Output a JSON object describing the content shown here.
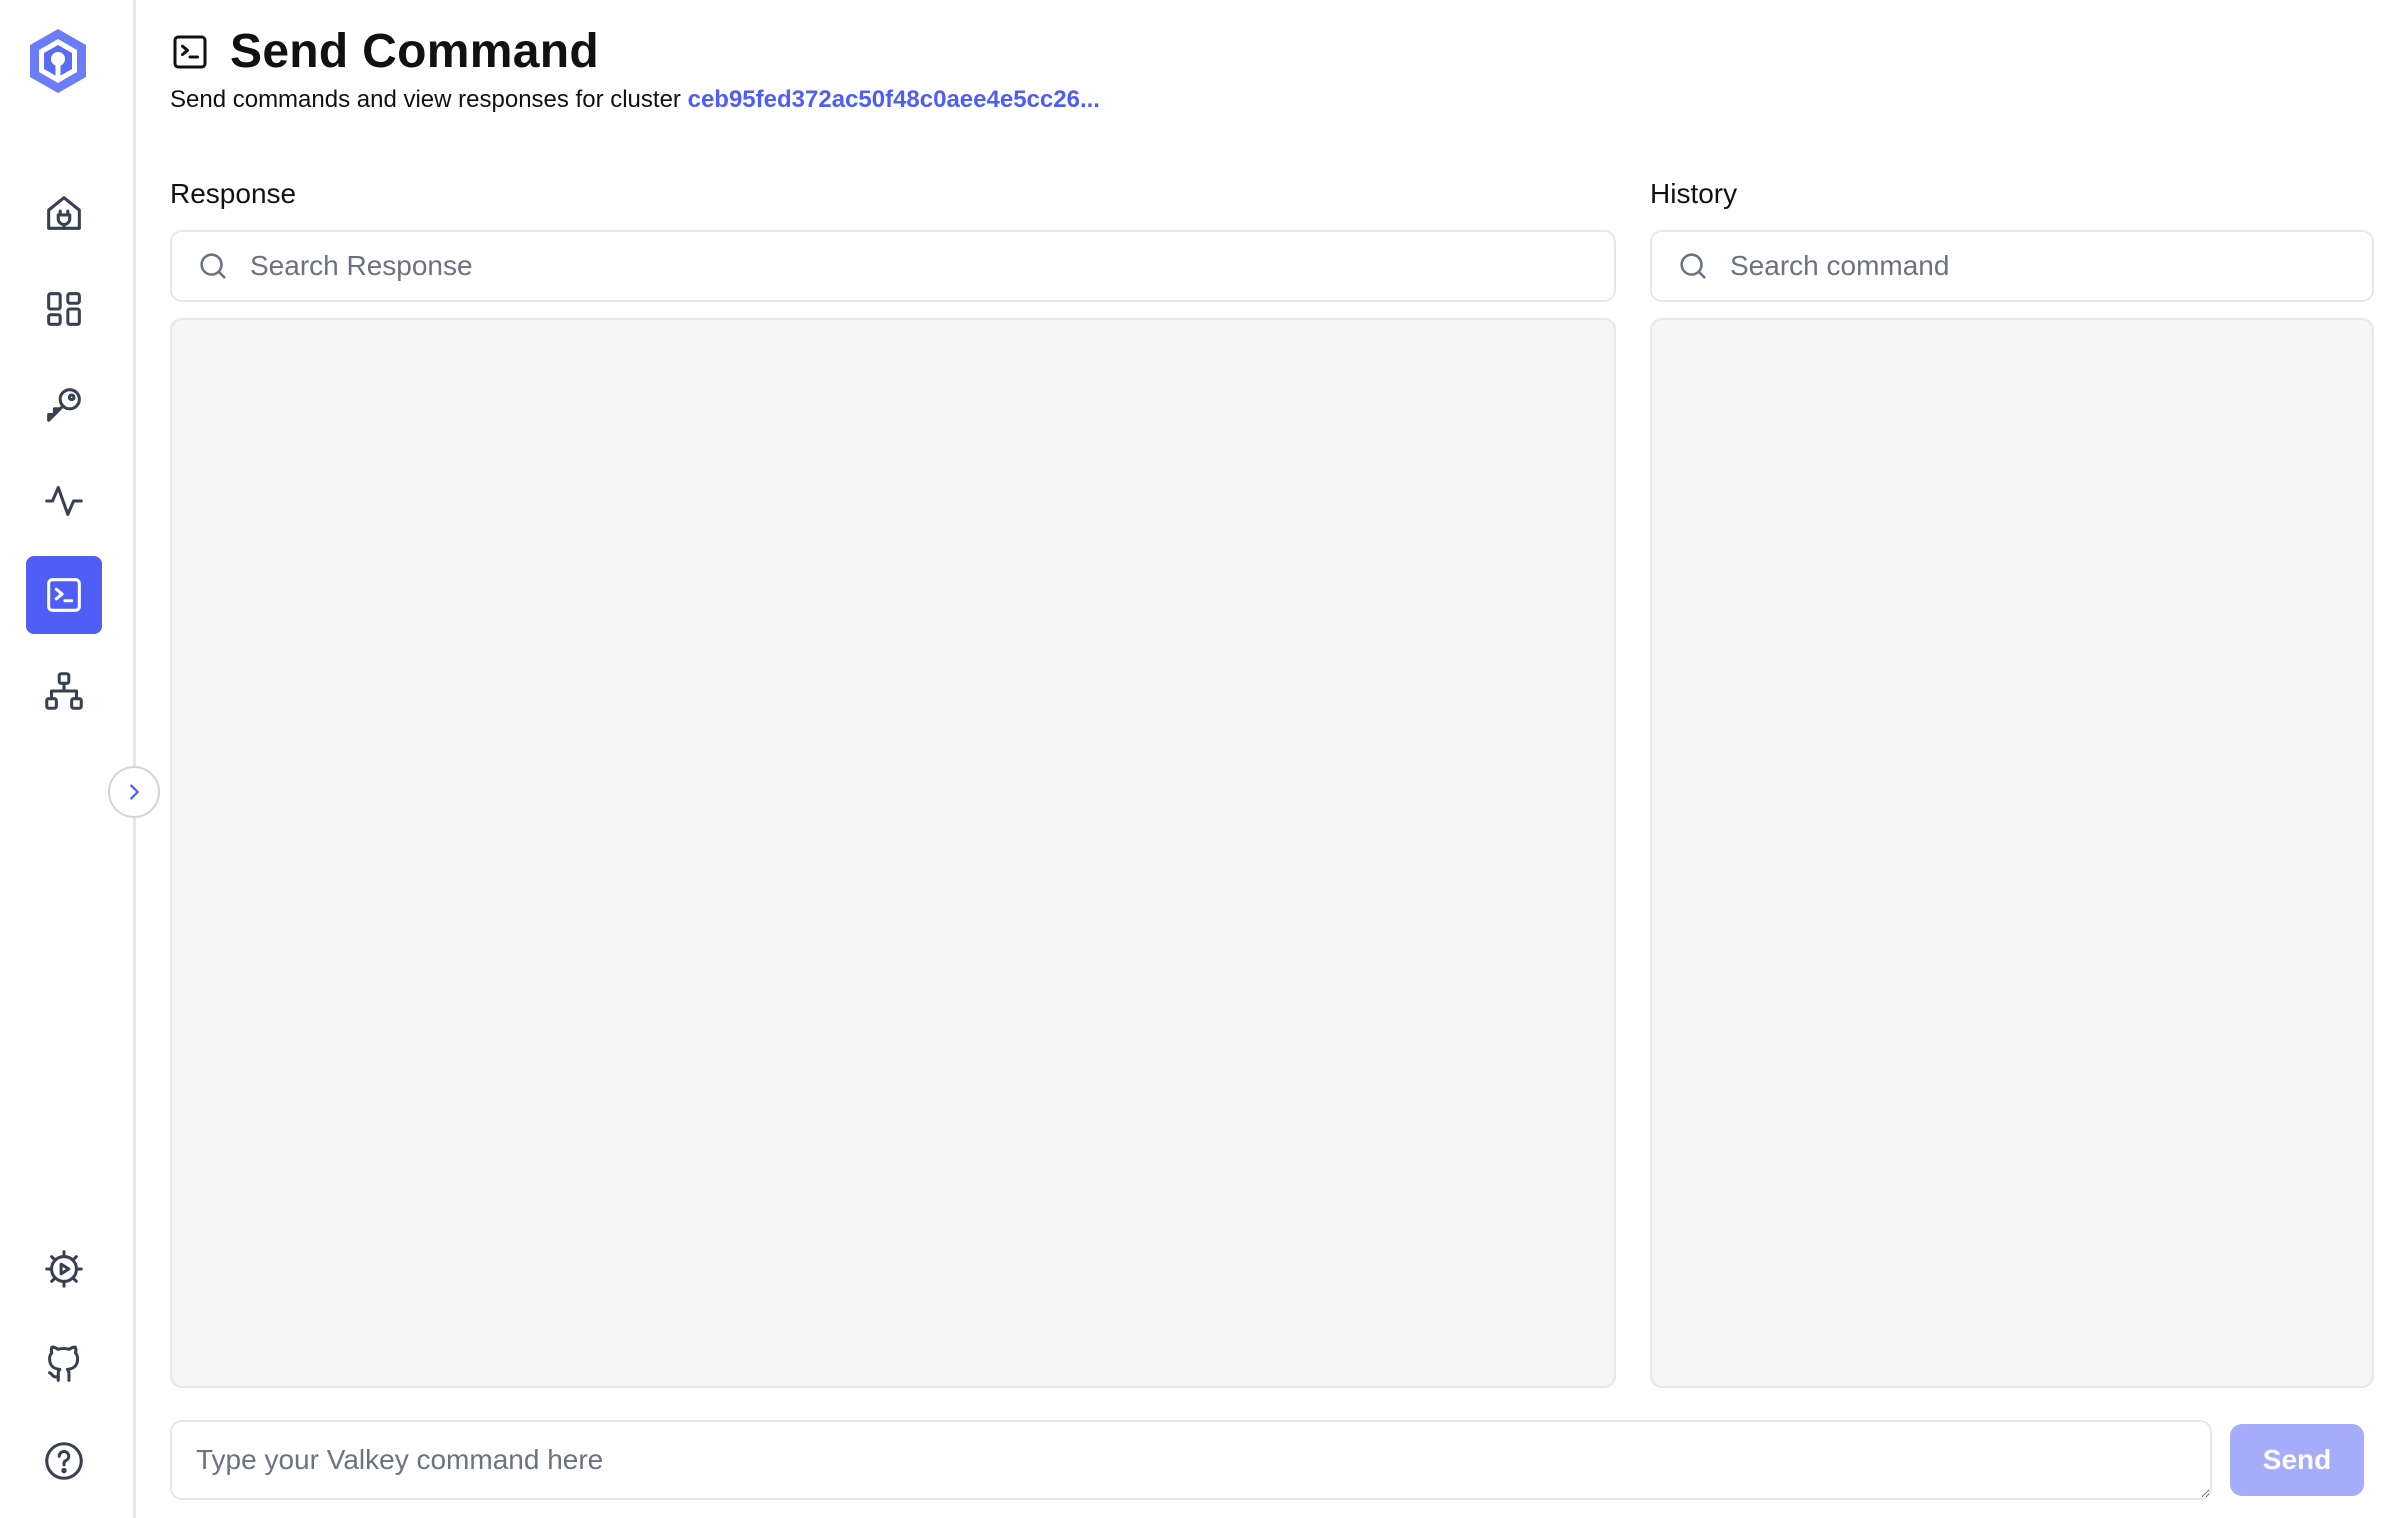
{
  "sidebar": {
    "items": [
      {
        "name": "home",
        "icon": "home-plug-icon"
      },
      {
        "name": "dashboard",
        "icon": "grid-icon"
      },
      {
        "name": "keys",
        "icon": "key-icon"
      },
      {
        "name": "monitoring",
        "icon": "activity-icon"
      },
      {
        "name": "send-command",
        "icon": "terminal-icon",
        "active": true
      },
      {
        "name": "cluster-topology",
        "icon": "network-icon"
      }
    ],
    "bottom": [
      {
        "name": "settings",
        "icon": "gear-icon"
      },
      {
        "name": "github",
        "icon": "github-icon"
      },
      {
        "name": "help",
        "icon": "help-circle-icon"
      }
    ],
    "accent": "#4f5ef7"
  },
  "header": {
    "title": "Send Command",
    "subtitle": "Send commands and view responses for cluster",
    "cluster_id": "ceb95fed372ac50f48c0aee4e5cc26..."
  },
  "response": {
    "label": "Response",
    "search_placeholder": "Search Response"
  },
  "history": {
    "label": "History",
    "search_placeholder": "Search command"
  },
  "command": {
    "placeholder": "Type your Valkey command here",
    "send_label": "Send"
  }
}
